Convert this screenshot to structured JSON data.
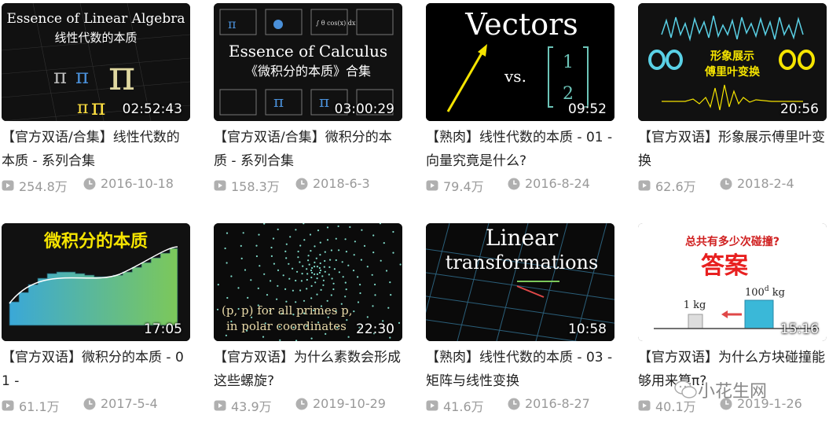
{
  "videos": [
    {
      "thumb_text": {
        "t1": "Essence of Linear Algebra",
        "t2": "线性代数的本质"
      },
      "duration": "02:52:43",
      "title": "【官方双语/合集】线性代数的本质 - 系列合集",
      "views": "254.8万",
      "date": "2016-10-18"
    },
    {
      "thumb_text": {
        "t1": "Essence of Calculus",
        "t2": "《微积分的本质》合集"
      },
      "duration": "03:00:29",
      "title": "【官方双语/合集】微积分的本质 - 系列合集",
      "views": "158.3万",
      "date": "2018-6-3"
    },
    {
      "thumb_text": {
        "t1": "Vectors",
        "t2": "vs.",
        "n1": "1",
        "n2": "2"
      },
      "duration": "09:52",
      "title": "【熟肉】线性代数的本质 - 01 - 向量究竟是什么?",
      "views": "79.4万",
      "date": "2016-8-24"
    },
    {
      "thumb_text": {
        "t1": "形象展示",
        "t2": "傅里叶变换"
      },
      "duration": "20:56",
      "title": "【官方双语】形象展示傅里叶变换",
      "views": "62.6万",
      "date": "2018-2-4"
    },
    {
      "thumb_text": {
        "t1": "微积分的本质"
      },
      "duration": "17:05",
      "title": "【官方双语】微积分的本质 - 01 -",
      "views": "61.1万",
      "date": "2017-5-4"
    },
    {
      "thumb_text": {
        "t1": "(p, p) for all primes p,",
        "t2": "in polar coordinates"
      },
      "duration": "22:30",
      "title": "【官方双语】为什么素数会形成这些螺旋?",
      "views": "43.9万",
      "date": "2019-10-29"
    },
    {
      "thumb_text": {
        "t1": "Linear",
        "t2": "transformations"
      },
      "duration": "10:58",
      "title": "【熟肉】线性代数的本质 - 03 - 矩阵与线性变换",
      "views": "41.6万",
      "date": "2016-8-27"
    },
    {
      "thumb_text": {
        "t1": "总共有多少次碰撞?",
        "t2": "答案",
        "l1": "1 kg",
        "l2": "100",
        "l2sup": "d",
        "l2unit": " kg"
      },
      "duration": "15:16",
      "title": "【官方双语】为什么方块碰撞能够用来算π?",
      "views": "40.1万",
      "date": "2019-1-26"
    }
  ],
  "watermark": {
    "text": "小花生网",
    "icon": "wechat-icon"
  },
  "icons": {
    "views": "play-count-icon",
    "date": "clock-icon"
  },
  "colors": {
    "meta_gray": "#999999",
    "title_text": "#222222",
    "thumb_bg": "#000000"
  }
}
